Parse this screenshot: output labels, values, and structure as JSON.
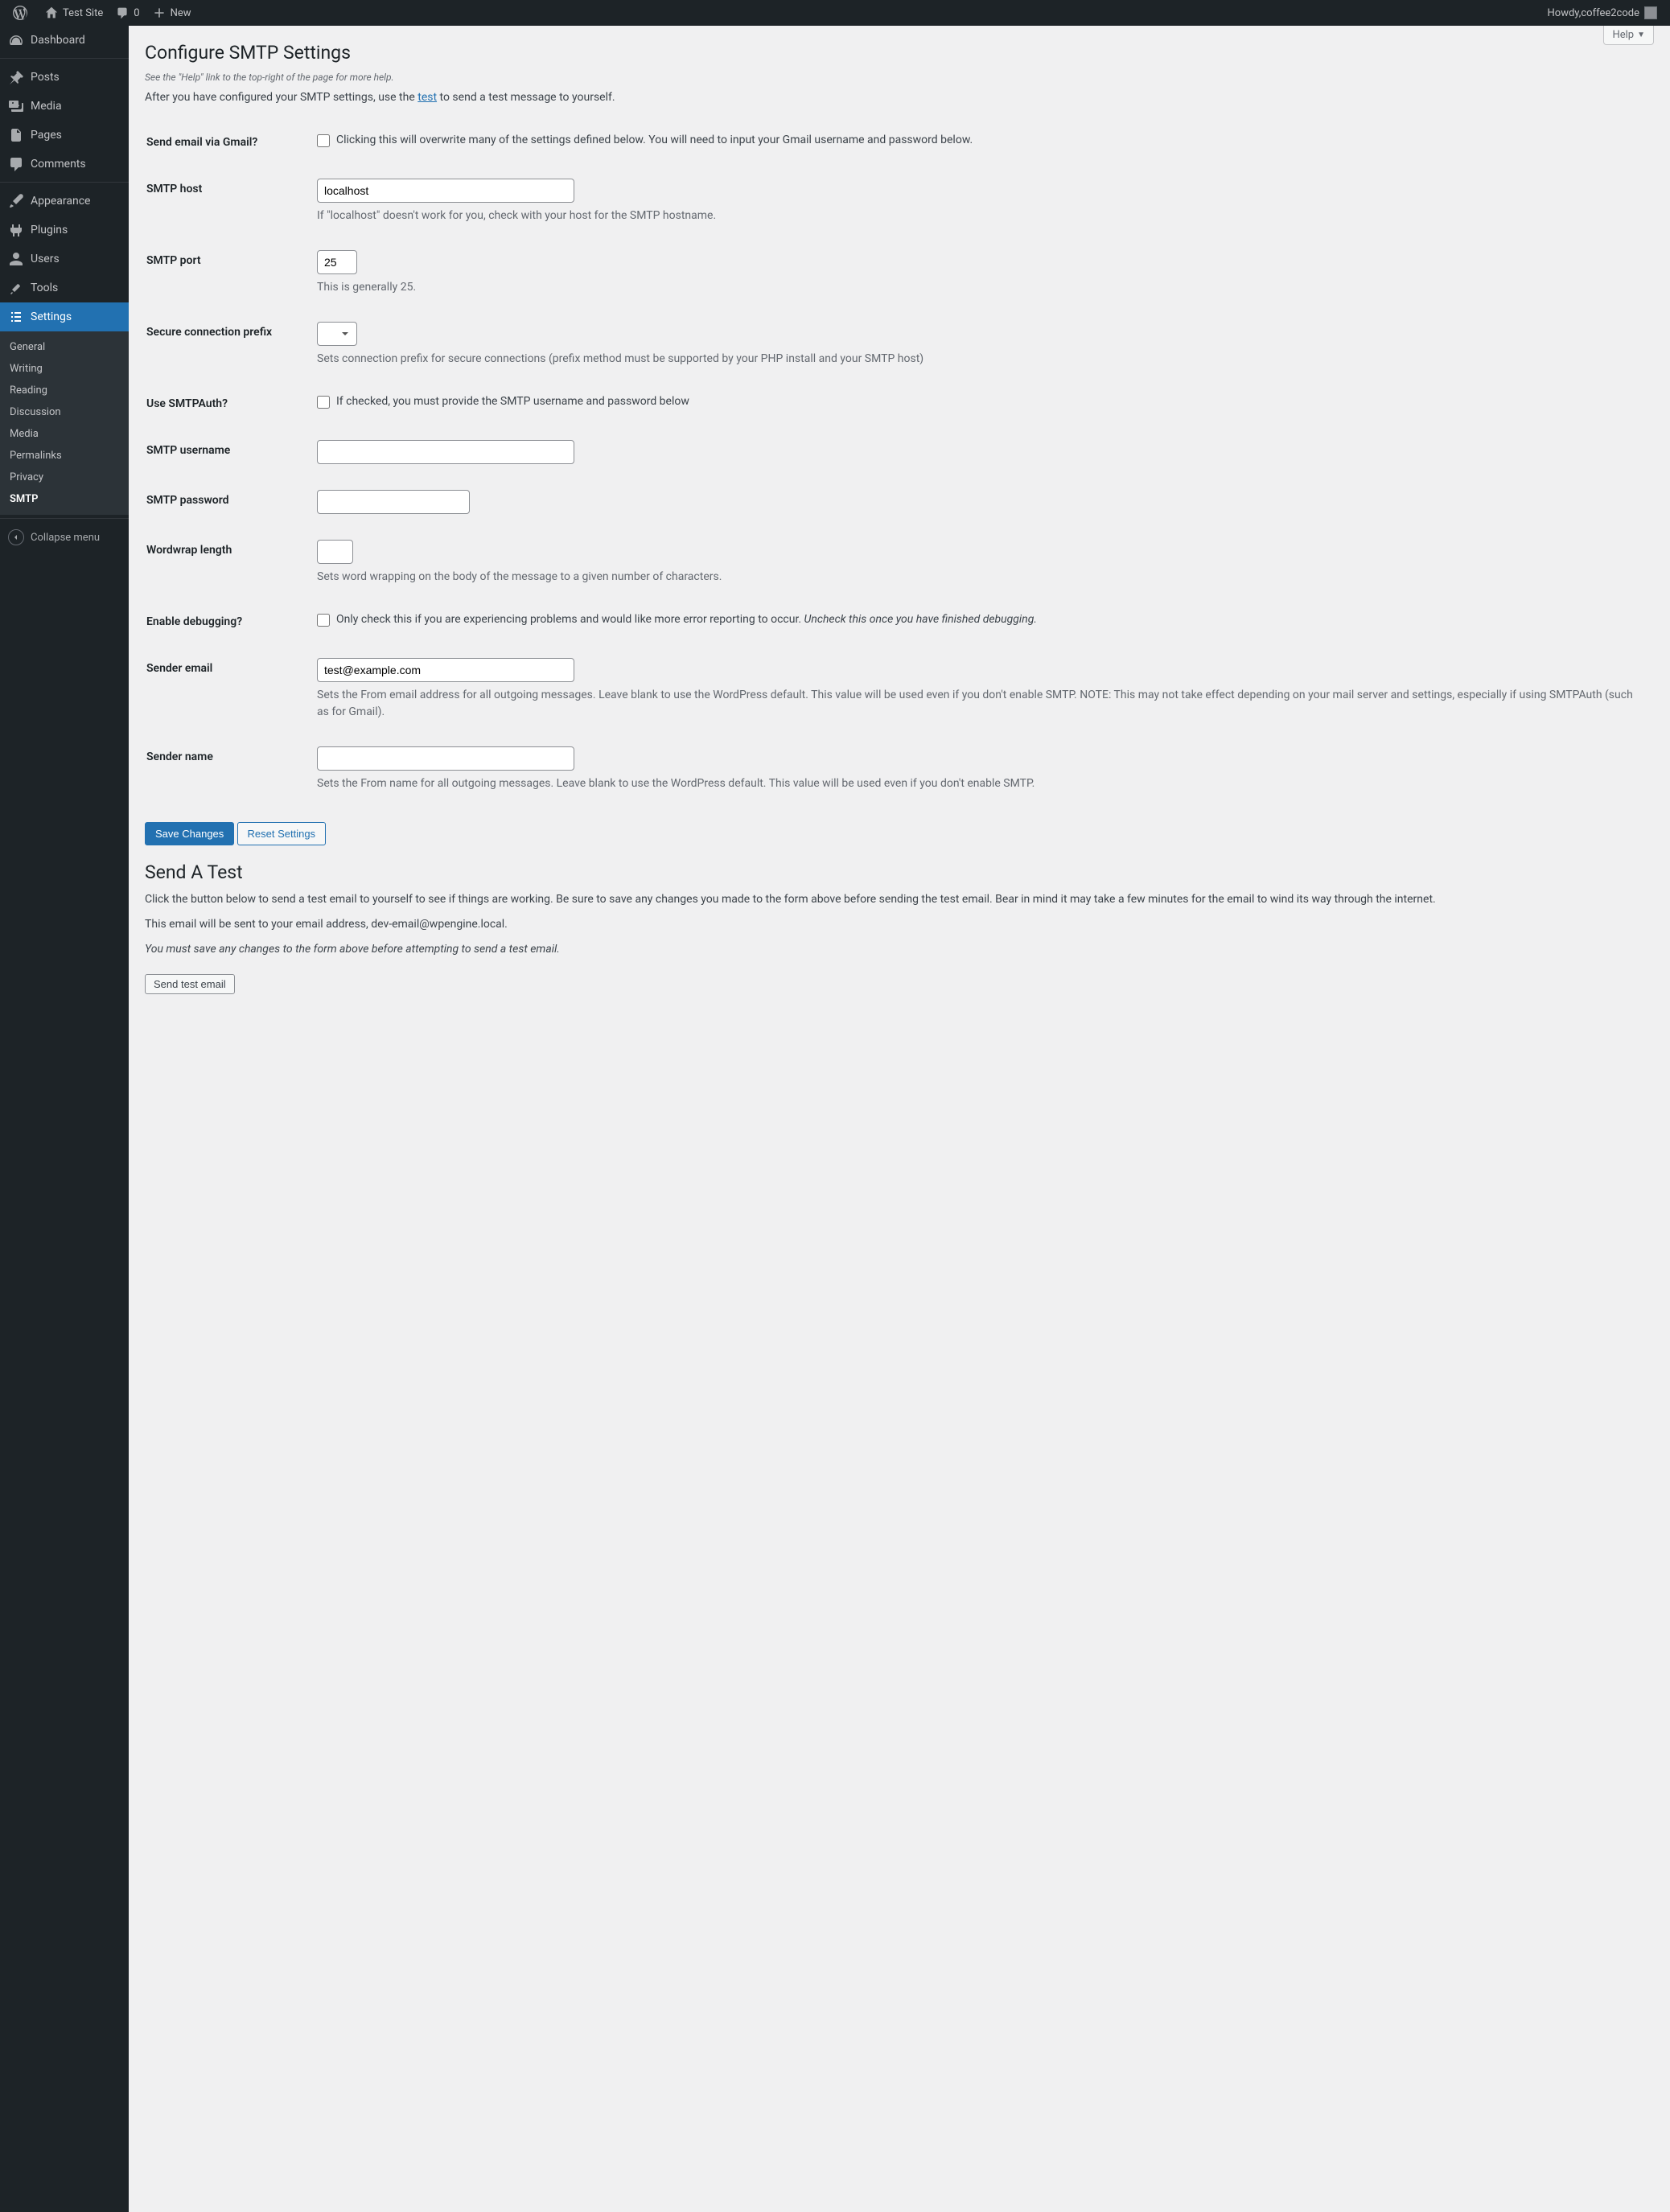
{
  "adminbar": {
    "site_name": "Test Site",
    "comments_count": "0",
    "new_label": "New",
    "howdy_prefix": "Howdy, ",
    "username": "coffee2code"
  },
  "sidebar": {
    "items": [
      {
        "label": "Dashboard"
      },
      {
        "label": "Posts"
      },
      {
        "label": "Media"
      },
      {
        "label": "Pages"
      },
      {
        "label": "Comments"
      },
      {
        "label": "Appearance"
      },
      {
        "label": "Plugins"
      },
      {
        "label": "Users"
      },
      {
        "label": "Tools"
      },
      {
        "label": "Settings"
      }
    ],
    "submenu_settings": [
      {
        "label": "General"
      },
      {
        "label": "Writing"
      },
      {
        "label": "Reading"
      },
      {
        "label": "Discussion"
      },
      {
        "label": "Media"
      },
      {
        "label": "Permalinks"
      },
      {
        "label": "Privacy"
      },
      {
        "label": "SMTP"
      }
    ],
    "collapse_label": "Collapse menu"
  },
  "help_tab": "Help",
  "page": {
    "title": "Configure SMTP Settings",
    "help_hint": "See the \"Help\" link to the top-right of the page for more help.",
    "intro_before": "After you have configured your SMTP settings, use the ",
    "intro_link": "test",
    "intro_after": " to send a test message to yourself."
  },
  "fields": {
    "gmail": {
      "label": "Send email via Gmail?",
      "desc": "Clicking this will overwrite many of the settings defined below. You will need to input your Gmail username and password below."
    },
    "host": {
      "label": "SMTP host",
      "value": "localhost",
      "desc": "If \"localhost\" doesn't work for you, check with your host for the SMTP hostname."
    },
    "port": {
      "label": "SMTP port",
      "value": "25",
      "desc": "This is generally 25."
    },
    "secure": {
      "label": "Secure connection prefix",
      "desc": "Sets connection prefix for secure connections (prefix method must be supported by your PHP install and your SMTP host)"
    },
    "auth": {
      "label": "Use SMTPAuth?",
      "desc": "If checked, you must provide the SMTP username and password below"
    },
    "user": {
      "label": "SMTP username",
      "value": ""
    },
    "pass": {
      "label": "SMTP password",
      "value": ""
    },
    "wrap": {
      "label": "Wordwrap length",
      "value": "",
      "desc": "Sets word wrapping on the body of the message to a given number of characters."
    },
    "debug": {
      "label": "Enable debugging?",
      "desc_a": "Only check this if you are experiencing problems and would like more error reporting to occur. ",
      "desc_b": "Uncheck this once you have finished debugging."
    },
    "sender_email": {
      "label": "Sender email",
      "value": "test@example.com",
      "desc": "Sets the From email address for all outgoing messages. Leave blank to use the WordPress default. This value will be used even if you don't enable SMTP. NOTE: This may not take effect depending on your mail server and settings, especially if using SMTPAuth (such as for Gmail)."
    },
    "sender_name": {
      "label": "Sender name",
      "value": "",
      "desc": "Sets the From name for all outgoing messages. Leave blank to use the WordPress default. This value will be used even if you don't enable SMTP."
    }
  },
  "buttons": {
    "save": "Save Changes",
    "reset": "Reset Settings",
    "send_test": "Send test email"
  },
  "test": {
    "heading": "Send A Test",
    "p1": "Click the button below to send a test email to yourself to see if things are working. Be sure to save any changes you made to the form above before sending the test email. Bear in mind it may take a few minutes for the email to wind its way through the internet.",
    "p2": "This email will be sent to your email address, dev-email@wpengine.local.",
    "p3": "You must save any changes to the form above before attempting to send a test email."
  }
}
